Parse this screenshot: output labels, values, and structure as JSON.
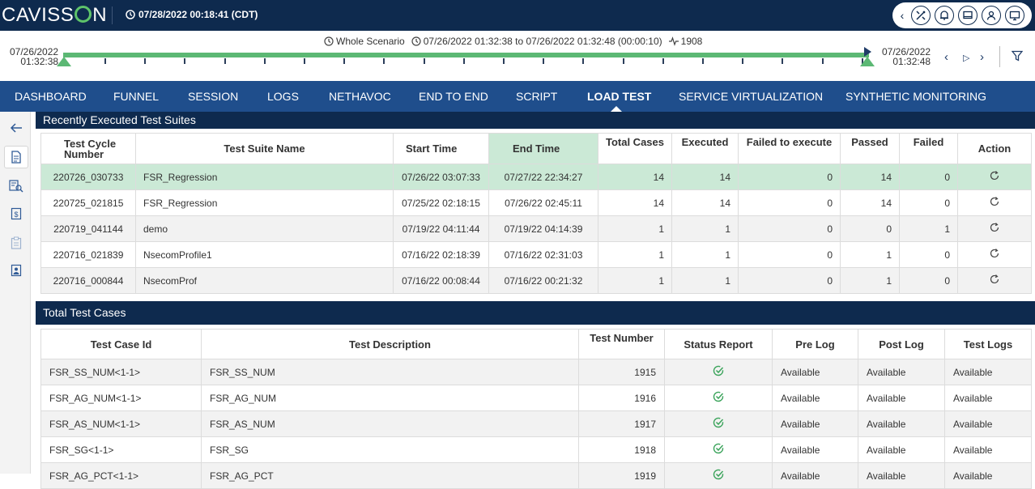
{
  "header": {
    "logo_text": "CAVISSON",
    "datetime": "07/28/2022 00:18:41 (CDT)",
    "tools": [
      "chevron-left",
      "tools-icon",
      "bell-icon",
      "monitor-icon",
      "user-icon",
      "screen-icon"
    ]
  },
  "timeline": {
    "scope": "Whole Scenario",
    "range": "07/26/2022 01:32:38 to 07/26/2022 01:32:48 (00:00:10)",
    "count": "1908",
    "start_date": "07/26/2022",
    "start_time": "01:32:38",
    "end_date": "07/26/2022",
    "end_time": "01:32:48"
  },
  "nav": {
    "items": [
      "DASHBOARD",
      "FUNNEL",
      "SESSION",
      "LOGS",
      "NETHAVOC",
      "END TO END",
      "SCRIPT",
      "LOAD TEST",
      "SERVICE VIRTUALIZATION",
      "SYNTHETIC MONITORING"
    ],
    "active": "LOAD TEST"
  },
  "suites": {
    "title": "Recently Executed Test Suites",
    "headers": [
      "Test Cycle Number",
      "Test Suite Name",
      "Start Time",
      "End Time",
      "Total Cases",
      "Executed",
      "Failed to execute",
      "Passed",
      "Failed",
      "Action"
    ],
    "rows": [
      [
        "220726_030733",
        "FSR_Regression",
        "07/26/22 03:07:33",
        "07/27/22 22:34:27",
        "14",
        "14",
        "0",
        "14",
        "0"
      ],
      [
        "220725_021815",
        "FSR_Regression",
        "07/25/22 02:18:15",
        "07/26/22 02:45:11",
        "14",
        "14",
        "0",
        "14",
        "0"
      ],
      [
        "220719_041144",
        "demo",
        "07/19/22 04:11:44",
        "07/19/22 04:14:39",
        "1",
        "1",
        "0",
        "0",
        "1"
      ],
      [
        "220716_021839",
        "NsecomProfile1",
        "07/16/22 02:18:39",
        "07/16/22 02:31:03",
        "1",
        "1",
        "0",
        "1",
        "0"
      ],
      [
        "220716_000844",
        "NsecomProf",
        "07/16/22 00:08:44",
        "07/16/22 00:21:32",
        "1",
        "1",
        "0",
        "1",
        "0"
      ]
    ]
  },
  "cases": {
    "title": "Total Test Cases",
    "headers": [
      "Test Case Id",
      "Test Description",
      "Test Number",
      "Status Report",
      "Pre Log",
      "Post Log",
      "Test Logs"
    ],
    "rows": [
      [
        "FSR_SS_NUM<1-1>",
        "FSR_SS_NUM",
        "1915",
        "Available",
        "Available",
        "Available"
      ],
      [
        "FSR_AG_NUM<1-1>",
        "FSR_AG_NUM",
        "1916",
        "Available",
        "Available",
        "Available"
      ],
      [
        "FSR_AS_NUM<1-1>",
        "FSR_AS_NUM",
        "1917",
        "Available",
        "Available",
        "Available"
      ],
      [
        "FSR_SG<1-1>",
        "FSR_SG",
        "1918",
        "Available",
        "Available",
        "Available"
      ],
      [
        "FSR_AG_PCT<1-1>",
        "FSR_AG_PCT",
        "1919",
        "Available",
        "Available",
        "Available"
      ]
    ]
  },
  "colors": {
    "header_bg": "#0e2a4e",
    "nav_bg": "#1f4e8c",
    "accent_green": "#5cb874",
    "selected_row": "#cbe9d6"
  }
}
